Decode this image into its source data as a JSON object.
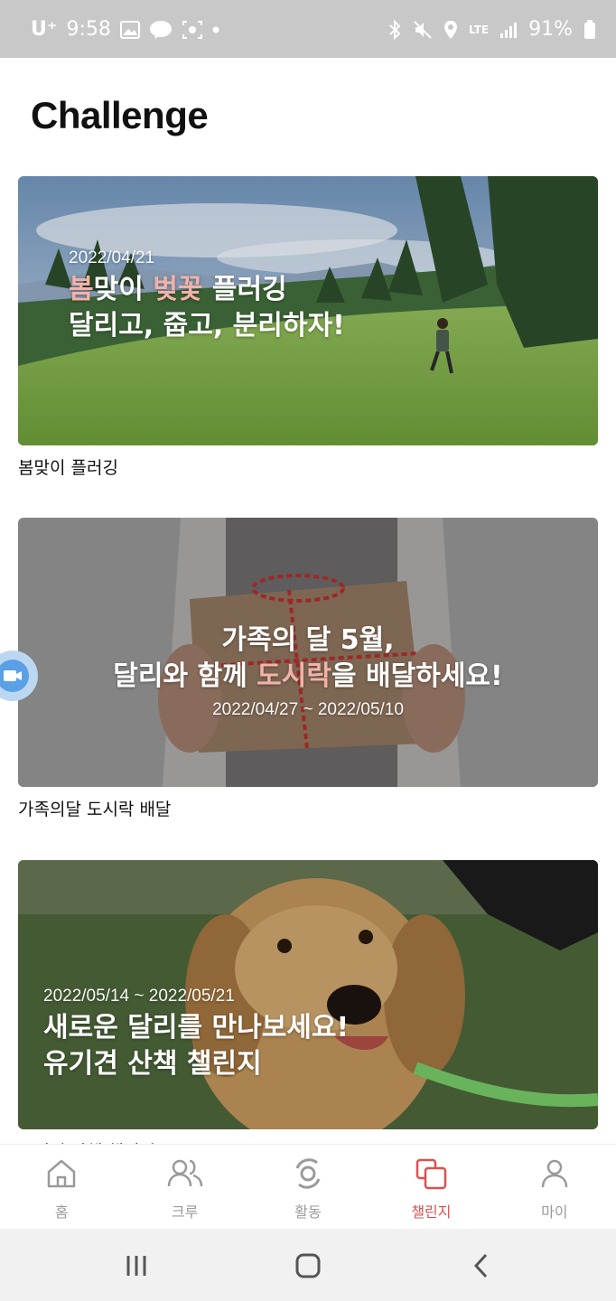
{
  "status_bar": {
    "carrier": "U⁺",
    "time": "9:58",
    "battery": "91%",
    "network": "LTE"
  },
  "page": {
    "title": "Challenge"
  },
  "challenges": [
    {
      "banner_date": "2022/04/21",
      "banner_line1_hl1": "봄",
      "banner_line1_a": "맞이 ",
      "banner_line1_hl2": "벚꽃",
      "banner_line1_b": " 플러깅",
      "banner_line2": "달리고, 줍고, 분리하자!",
      "label": "봄맞이 플러깅"
    },
    {
      "banner_line1": "가족의 달 5월,",
      "banner_line2_a": "달리와 함께 ",
      "banner_line2_hl": "도시락",
      "banner_line2_b": "을 배달하세요!",
      "banner_date": "2022/04/27 ~ 2022/05/10",
      "label": "가족의달 도시락 배달"
    },
    {
      "banner_date": "2022/05/14 ~ 2022/05/21",
      "banner_line1": "새로운 달리를 만나보세요!",
      "banner_line2": "유기견 산책 챌린지",
      "label": "유기견 산책 챌린지"
    }
  ],
  "bottom_nav": {
    "items": [
      {
        "label": "홈",
        "icon": "home-icon"
      },
      {
        "label": "크루",
        "icon": "people-icon"
      },
      {
        "label": "활동",
        "icon": "activity-icon"
      },
      {
        "label": "챌린지",
        "icon": "challenge-icon",
        "active": true
      },
      {
        "label": "마이",
        "icon": "person-icon"
      }
    ]
  },
  "colors": {
    "accent": "#d9534f",
    "highlight": "#f2b2aa"
  }
}
